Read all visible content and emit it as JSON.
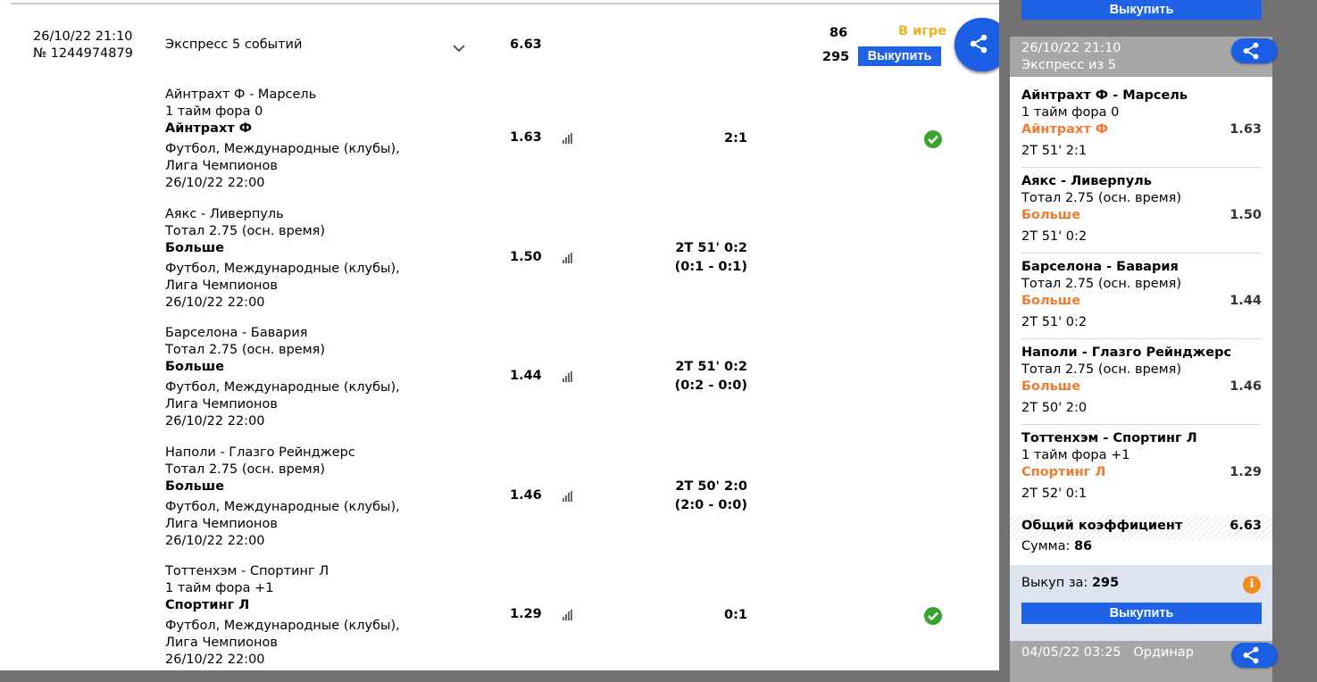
{
  "bet": {
    "datetime": "26/10/22 21:10",
    "number": "№ 1244974879",
    "title": "Экспресс 5 событий",
    "total_odd": "6.63",
    "stake": "86",
    "payout": "295",
    "status": "В игре",
    "buyout_label": "Выкупить"
  },
  "events": [
    {
      "match": "Айнтрахт Ф - Марсель",
      "market": "1 тайм фора 0",
      "pick": "Айнтрахт Ф",
      "league1": "Футбол, Международные (клубы),",
      "league2": "Лига Чемпионов",
      "date": "26/10/22 22:00",
      "odd": "1.63",
      "score1": "2:1",
      "score2": "",
      "won": true
    },
    {
      "match": "Аякс - Ливерпуль",
      "market": "Тотал 2.75 (осн. время)",
      "pick": "Больше",
      "league1": "Футбол, Международные (клубы),",
      "league2": "Лига Чемпионов",
      "date": "26/10/22 22:00",
      "odd": "1.50",
      "score1": "2Т 51' 0:2",
      "score2": "(0:1 - 0:1)",
      "won": false
    },
    {
      "match": "Барселона - Бавария",
      "market": "Тотал 2.75 (осн. время)",
      "pick": "Больше",
      "league1": "Футбол, Международные (клубы),",
      "league2": "Лига Чемпионов",
      "date": "26/10/22 22:00",
      "odd": "1.44",
      "score1": "2Т 51' 0:2",
      "score2": "(0:2 - 0:0)",
      "won": false
    },
    {
      "match": "Наполи - Глазго Рейнджерс",
      "market": "Тотал 2.75 (осн. время)",
      "pick": "Больше",
      "league1": "Футбол, Международные (клубы),",
      "league2": "Лига Чемпионов",
      "date": "26/10/22 22:00",
      "odd": "1.46",
      "score1": "2Т 50' 2:0",
      "score2": "(2:0 - 0:0)",
      "won": false
    },
    {
      "match": "Тоттенхэм - Спортинг Л",
      "market": "1 тайм фора +1",
      "pick": "Спортинг Л",
      "league1": "Футбол, Международные (клубы),",
      "league2": "Лига Чемпионов",
      "date": "26/10/22 22:00",
      "odd": "1.29",
      "score1": "0:1",
      "score2": "",
      "won": true
    }
  ],
  "panel": {
    "top_button": "Выкупить",
    "card": {
      "datetime": "26/10/22 21:10",
      "type": "Экспресс из 5",
      "legs": [
        {
          "match": "Айнтрахт Ф - Марсель",
          "market": "1 тайм фора 0",
          "pick": "Айнтрахт Ф",
          "odd": "1.63",
          "live": "2Т 51' 2:1"
        },
        {
          "match": "Аякс - Ливерпуль",
          "market": "Тотал 2.75 (осн. время)",
          "pick": "Больше",
          "odd": "1.50",
          "live": "2Т 51' 0:2"
        },
        {
          "match": "Барселона - Бавария",
          "market": "Тотал 2.75 (осн. время)",
          "pick": "Больше",
          "odd": "1.44",
          "live": "2Т 51' 0:2"
        },
        {
          "match": "Наполи - Глазго Рейнджерс",
          "market": "Тотал 2.75 (осн. время)",
          "pick": "Больше",
          "odd": "1.46",
          "live": "2Т 50' 2:0"
        },
        {
          "match": "Тоттенхэм - Спортинг Л",
          "market": "1 тайм фора +1",
          "pick": "Спортинг Л",
          "odd": "1.29",
          "live": "2Т 52' 0:1"
        }
      ],
      "total_label": "Общий коэффициент",
      "total_value": "6.63",
      "sum_label": "Сумма:",
      "sum_value": "86",
      "buyout_for_label": "Выкуп за:",
      "buyout_for_value": "295",
      "buyout_button": "Выкупить"
    },
    "next_card": {
      "datetime": "04/05/22 03:25",
      "type": "Ординар"
    }
  },
  "colors": {
    "accent_blue": "#1f62e6",
    "status_yellow": "#f3b21b",
    "pick_orange": "#f07c32",
    "win_green": "#3aa32f"
  }
}
